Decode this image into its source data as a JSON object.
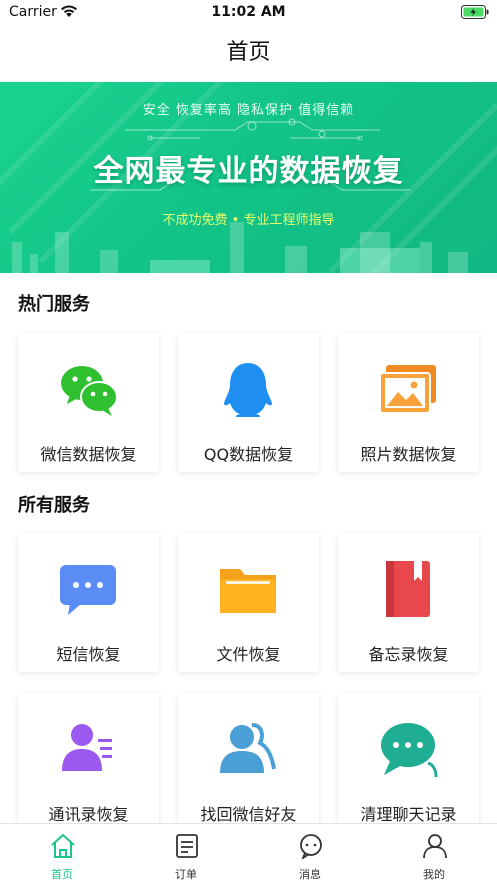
{
  "status": {
    "carrier": "Carrier",
    "time": "11:02 AM"
  },
  "nav": {
    "title": "首页"
  },
  "banner": {
    "subtitle": "安全 恢复率高 隐私保护 值得信赖",
    "title": "全网最专业的数据恢复",
    "tagline": "不成功免费  •  专业工程师指导"
  },
  "hot": {
    "title": "热门服务",
    "items": [
      {
        "label": "微信数据恢复",
        "icon": "wechat-icon"
      },
      {
        "label": "QQ数据恢复",
        "icon": "qq-icon"
      },
      {
        "label": "照片数据恢复",
        "icon": "photo-icon"
      }
    ]
  },
  "all": {
    "title": "所有服务",
    "items": [
      {
        "label": "短信恢复",
        "icon": "sms-icon"
      },
      {
        "label": "文件恢复",
        "icon": "folder-icon"
      },
      {
        "label": "备忘录恢复",
        "icon": "notebook-icon"
      },
      {
        "label": "通讯录恢复",
        "icon": "contacts-icon"
      },
      {
        "label": "找回微信好友",
        "icon": "friends-icon"
      },
      {
        "label": "清理聊天记录",
        "icon": "chat-icon"
      }
    ]
  },
  "tabs": [
    {
      "label": "首页",
      "icon": "home-icon"
    },
    {
      "label": "订单",
      "icon": "order-icon"
    },
    {
      "label": "消息",
      "icon": "message-icon"
    },
    {
      "label": "我的",
      "icon": "user-icon"
    }
  ],
  "colors": {
    "accent": "#1ec28b",
    "banner": "#13c487"
  }
}
